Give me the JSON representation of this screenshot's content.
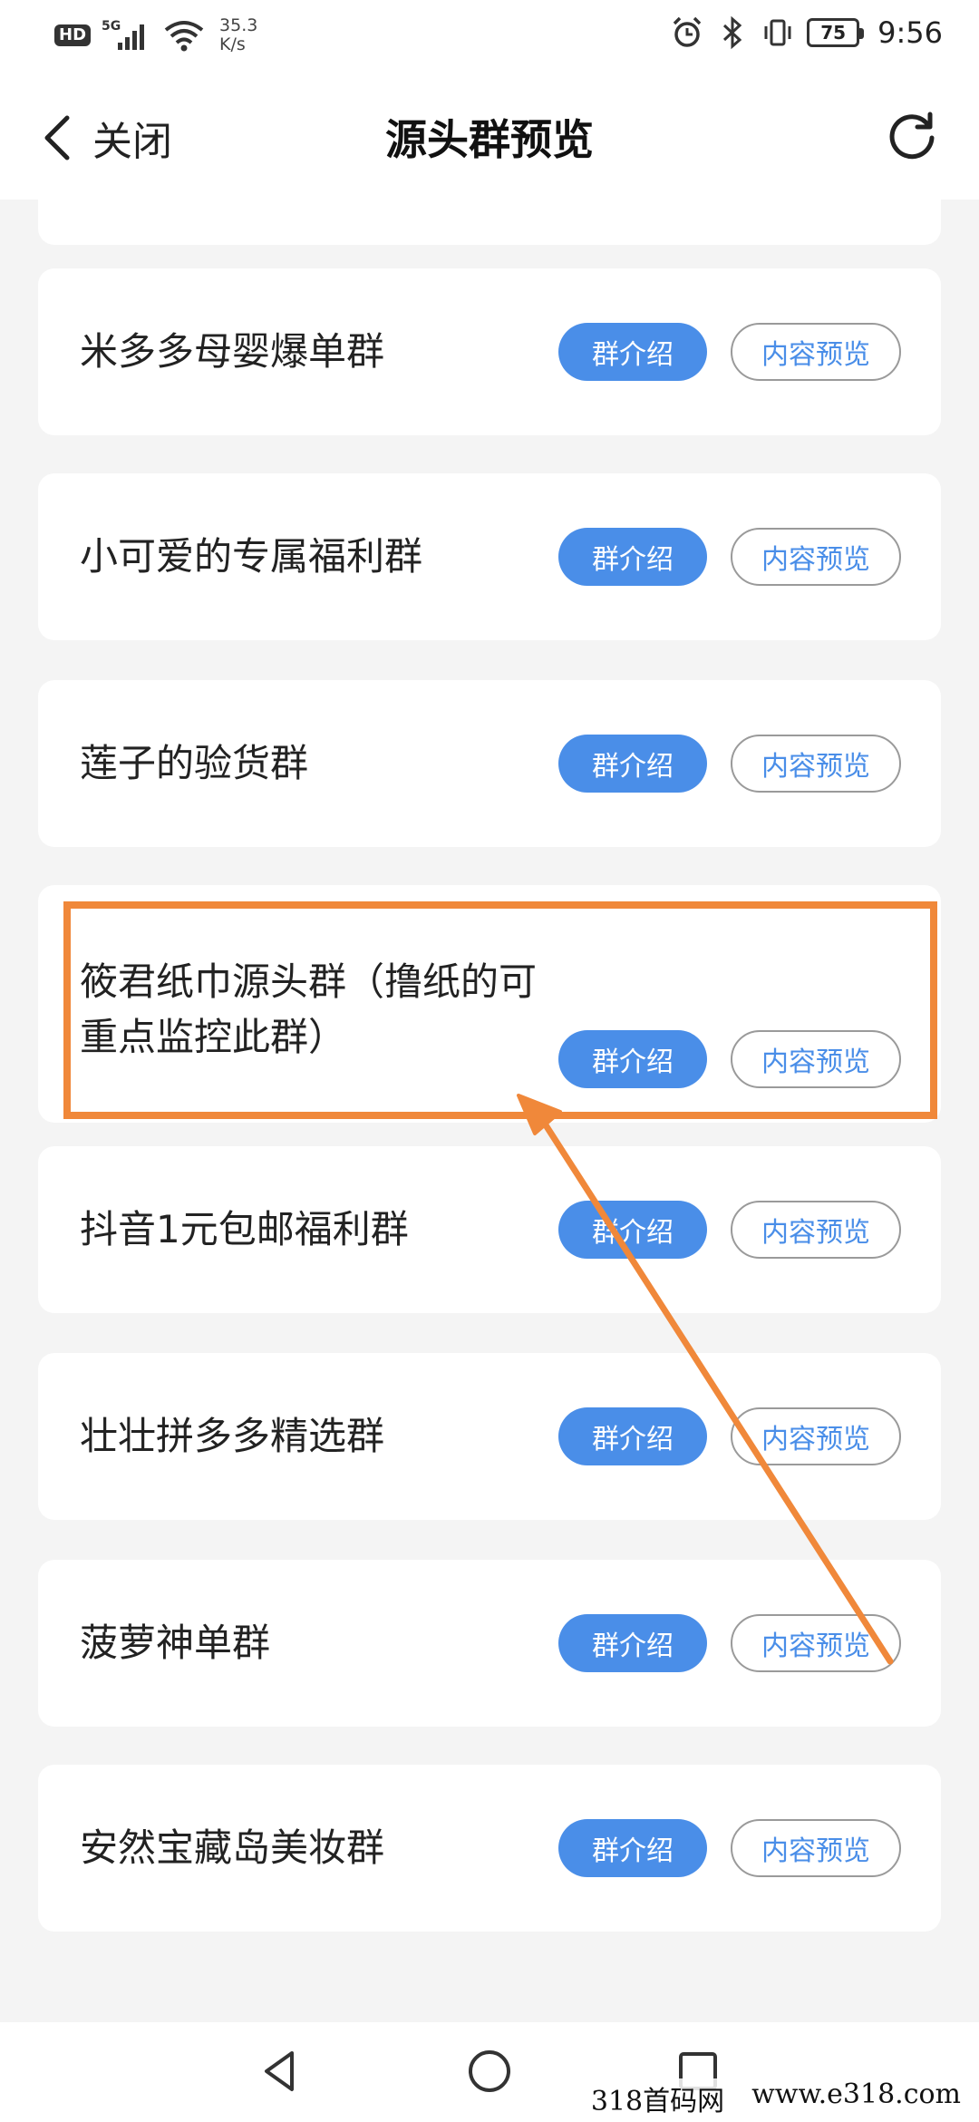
{
  "status_bar": {
    "hd": "HD",
    "network": "5G",
    "speed_value": "35.3",
    "speed_unit": "K/s",
    "battery": "75",
    "time": "9:56"
  },
  "header": {
    "back_label": "关闭",
    "title": "源头群预览"
  },
  "groups": [
    {
      "name": "米多多母婴爆单群",
      "intro_label": "群介绍",
      "preview_label": "内容预览"
    },
    {
      "name": "小可爱的专属福利群",
      "intro_label": "群介绍",
      "preview_label": "内容预览"
    },
    {
      "name": "莲子的验货群",
      "intro_label": "群介绍",
      "preview_label": "内容预览"
    },
    {
      "name": "筱君纸巾源头群（撸纸的可重点监控此群）",
      "intro_label": "群介绍",
      "preview_label": "内容预览",
      "highlighted": true
    },
    {
      "name": "抖音1元包邮福利群",
      "intro_label": "群介绍",
      "preview_label": "内容预览"
    },
    {
      "name": "壮壮拼多多精选群",
      "intro_label": "群介绍",
      "preview_label": "内容预览"
    },
    {
      "name": "菠萝神单群",
      "intro_label": "群介绍",
      "preview_label": "内容预览"
    },
    {
      "name": "安然宝藏岛美妆群",
      "intro_label": "群介绍",
      "preview_label": "内容预览"
    }
  ],
  "nav": {
    "icons": [
      "back-triangle-icon",
      "home-circle-icon",
      "recents-square-icon"
    ]
  },
  "watermark": {
    "left": "318首码网",
    "right": "www.e318.com"
  },
  "colors": {
    "accent": "#4a8ee8",
    "annotation": "#f0883a",
    "background": "#f4f4f4"
  }
}
